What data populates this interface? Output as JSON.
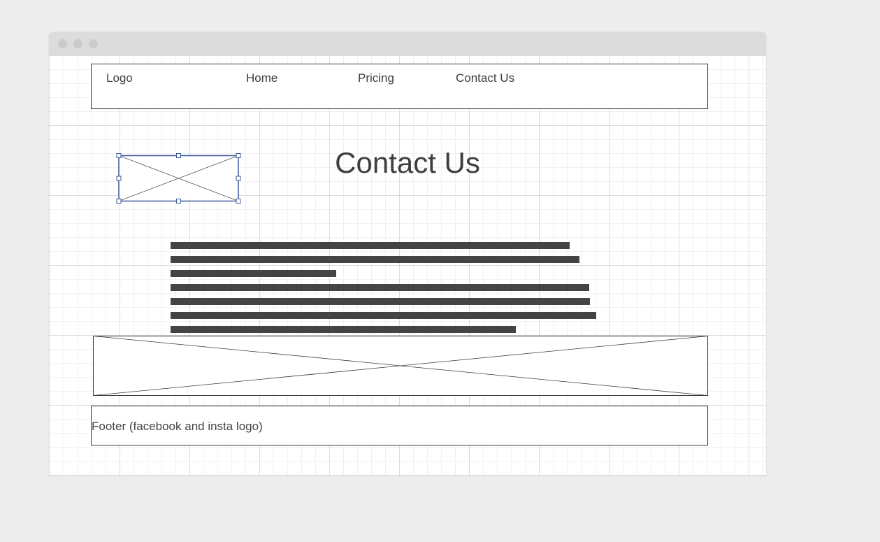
{
  "window": {
    "controls": [
      "close-dot",
      "minimize-dot",
      "zoom-dot"
    ]
  },
  "navbar": {
    "logo_label": "Logo",
    "home_label": "Home",
    "pricing_label": "Pricing",
    "contact_label": "Contact Us"
  },
  "main": {
    "title": "Contact Us",
    "text_line_count": 7
  },
  "footer": {
    "label": "Footer (facebook and insta logo)"
  },
  "colors": {
    "selection": "#3c5a99",
    "text_bar": "#444444",
    "border": "#3a3a3a"
  }
}
